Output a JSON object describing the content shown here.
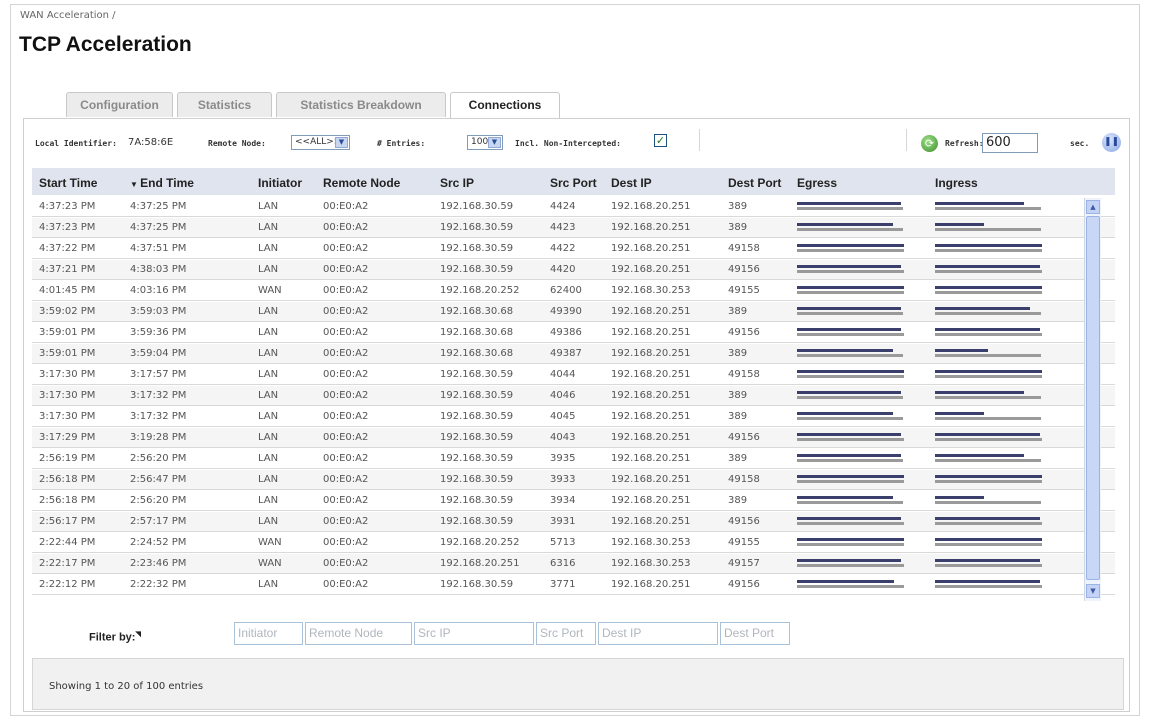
{
  "breadcrumb": "WAN Acceleration /",
  "title": "TCP Acceleration",
  "tabs": [
    {
      "label": "Configuration"
    },
    {
      "label": "Statistics"
    },
    {
      "label": "Statistics Breakdown"
    },
    {
      "label": "Connections"
    }
  ],
  "active_tab": "Connections",
  "toolbar": {
    "local_identifier_label": "Local Identifier:",
    "local_identifier_value": "7A:58:6E",
    "remote_node_label": "Remote Node:",
    "remote_node_value": "<<ALL>>",
    "entries_label": "# Entries:",
    "entries_value": "100",
    "non_intercepted_label": "Incl. Non-Intercepted:",
    "non_intercepted_checked": true,
    "refresh_label": "Refresh:",
    "refresh_value": "600",
    "refresh_unit": "sec."
  },
  "columns": [
    "Start Time",
    "End Time",
    "Initiator",
    "Remote Node",
    "Src IP",
    "Src Port",
    "Dest IP",
    "Dest Port",
    "Egress",
    "Ingress"
  ],
  "sort_column": "End Time",
  "rows": [
    {
      "start": "4:37:23 PM",
      "end": "4:37:25 PM",
      "initiator": "LAN",
      "node": "00:E0:A2",
      "src_ip": "192.168.30.59",
      "src_port": "4424",
      "dest_ip": "192.168.20.251",
      "dest_port": "389",
      "egress": [
        0.96,
        0.98
      ],
      "ingress": [
        0.82,
        0.98
      ]
    },
    {
      "start": "4:37:23 PM",
      "end": "4:37:25 PM",
      "initiator": "LAN",
      "node": "00:E0:A2",
      "src_ip": "192.168.30.59",
      "src_port": "4423",
      "dest_ip": "192.168.20.251",
      "dest_port": "389",
      "egress": [
        0.89,
        0.98
      ],
      "ingress": [
        0.45,
        0.98
      ]
    },
    {
      "start": "4:37:22 PM",
      "end": "4:37:51 PM",
      "initiator": "LAN",
      "node": "00:E0:A2",
      "src_ip": "192.168.30.59",
      "src_port": "4422",
      "dest_ip": "192.168.20.251",
      "dest_port": "49158",
      "egress": [
        0.99,
        0.99
      ],
      "ingress": [
        0.99,
        0.99
      ]
    },
    {
      "start": "4:37:21 PM",
      "end": "4:38:03 PM",
      "initiator": "LAN",
      "node": "00:E0:A2",
      "src_ip": "192.168.30.59",
      "src_port": "4420",
      "dest_ip": "192.168.20.251",
      "dest_port": "49156",
      "egress": [
        0.96,
        0.99
      ],
      "ingress": [
        0.97,
        0.99
      ]
    },
    {
      "start": "4:01:45 PM",
      "end": "4:03:16 PM",
      "initiator": "WAN",
      "node": "00:E0:A2",
      "src_ip": "192.168.20.252",
      "src_port": "62400",
      "dest_ip": "192.168.30.253",
      "dest_port": "49155",
      "egress": [
        0.99,
        0.99
      ],
      "ingress": [
        0.99,
        0.99
      ]
    },
    {
      "start": "3:59:02 PM",
      "end": "3:59:03 PM",
      "initiator": "LAN",
      "node": "00:E0:A2",
      "src_ip": "192.168.30.68",
      "src_port": "49390",
      "dest_ip": "192.168.20.251",
      "dest_port": "389",
      "egress": [
        0.96,
        0.98
      ],
      "ingress": [
        0.88,
        0.98
      ]
    },
    {
      "start": "3:59:01 PM",
      "end": "3:59:36 PM",
      "initiator": "LAN",
      "node": "00:E0:A2",
      "src_ip": "192.168.30.68",
      "src_port": "49386",
      "dest_ip": "192.168.20.251",
      "dest_port": "49156",
      "egress": [
        0.96,
        0.99
      ],
      "ingress": [
        0.97,
        0.99
      ]
    },
    {
      "start": "3:59:01 PM",
      "end": "3:59:04 PM",
      "initiator": "LAN",
      "node": "00:E0:A2",
      "src_ip": "192.168.30.68",
      "src_port": "49387",
      "dest_ip": "192.168.20.251",
      "dest_port": "389",
      "egress": [
        0.89,
        0.98
      ],
      "ingress": [
        0.49,
        0.98
      ]
    },
    {
      "start": "3:17:30 PM",
      "end": "3:17:57 PM",
      "initiator": "LAN",
      "node": "00:E0:A2",
      "src_ip": "192.168.30.59",
      "src_port": "4044",
      "dest_ip": "192.168.20.251",
      "dest_port": "49158",
      "egress": [
        0.99,
        0.99
      ],
      "ingress": [
        0.99,
        0.99
      ]
    },
    {
      "start": "3:17:30 PM",
      "end": "3:17:32 PM",
      "initiator": "LAN",
      "node": "00:E0:A2",
      "src_ip": "192.168.30.59",
      "src_port": "4046",
      "dest_ip": "192.168.20.251",
      "dest_port": "389",
      "egress": [
        0.96,
        0.98
      ],
      "ingress": [
        0.82,
        0.98
      ]
    },
    {
      "start": "3:17:30 PM",
      "end": "3:17:32 PM",
      "initiator": "LAN",
      "node": "00:E0:A2",
      "src_ip": "192.168.30.59",
      "src_port": "4045",
      "dest_ip": "192.168.20.251",
      "dest_port": "389",
      "egress": [
        0.89,
        0.98
      ],
      "ingress": [
        0.45,
        0.98
      ]
    },
    {
      "start": "3:17:29 PM",
      "end": "3:19:28 PM",
      "initiator": "LAN",
      "node": "00:E0:A2",
      "src_ip": "192.168.30.59",
      "src_port": "4043",
      "dest_ip": "192.168.20.251",
      "dest_port": "49156",
      "egress": [
        0.96,
        0.99
      ],
      "ingress": [
        0.97,
        0.99
      ]
    },
    {
      "start": "2:56:19 PM",
      "end": "2:56:20 PM",
      "initiator": "LAN",
      "node": "00:E0:A2",
      "src_ip": "192.168.30.59",
      "src_port": "3935",
      "dest_ip": "192.168.20.251",
      "dest_port": "389",
      "egress": [
        0.96,
        0.98
      ],
      "ingress": [
        0.82,
        0.98
      ]
    },
    {
      "start": "2:56:18 PM",
      "end": "2:56:47 PM",
      "initiator": "LAN",
      "node": "00:E0:A2",
      "src_ip": "192.168.30.59",
      "src_port": "3933",
      "dest_ip": "192.168.20.251",
      "dest_port": "49158",
      "egress": [
        0.99,
        0.99
      ],
      "ingress": [
        0.99,
        0.99
      ]
    },
    {
      "start": "2:56:18 PM",
      "end": "2:56:20 PM",
      "initiator": "LAN",
      "node": "00:E0:A2",
      "src_ip": "192.168.30.59",
      "src_port": "3934",
      "dest_ip": "192.168.20.251",
      "dest_port": "389",
      "egress": [
        0.89,
        0.98
      ],
      "ingress": [
        0.45,
        0.98
      ]
    },
    {
      "start": "2:56:17 PM",
      "end": "2:57:17 PM",
      "initiator": "LAN",
      "node": "00:E0:A2",
      "src_ip": "192.168.30.59",
      "src_port": "3931",
      "dest_ip": "192.168.20.251",
      "dest_port": "49156",
      "egress": [
        0.96,
        0.99
      ],
      "ingress": [
        0.97,
        0.99
      ]
    },
    {
      "start": "2:22:44 PM",
      "end": "2:24:52 PM",
      "initiator": "WAN",
      "node": "00:E0:A2",
      "src_ip": "192.168.20.252",
      "src_port": "5713",
      "dest_ip": "192.168.30.253",
      "dest_port": "49155",
      "egress": [
        0.99,
        0.99
      ],
      "ingress": [
        0.99,
        0.99
      ]
    },
    {
      "start": "2:22:17 PM",
      "end": "2:23:46 PM",
      "initiator": "WAN",
      "node": "00:E0:A2",
      "src_ip": "192.168.20.251",
      "src_port": "6316",
      "dest_ip": "192.168.30.253",
      "dest_port": "49157",
      "egress": [
        0.96,
        0.99
      ],
      "ingress": [
        0.97,
        0.99
      ]
    },
    {
      "start": "2:22:12 PM",
      "end": "2:22:32 PM",
      "initiator": "LAN",
      "node": "00:E0:A2",
      "src_ip": "192.168.30.59",
      "src_port": "3771",
      "dest_ip": "192.168.20.251",
      "dest_port": "49156",
      "egress": [
        0.9,
        0.99
      ],
      "ingress": [
        0.97,
        0.99
      ]
    }
  ],
  "filter": {
    "label": "Filter by:",
    "fields": [
      {
        "placeholder": "Initiator"
      },
      {
        "placeholder": "Remote Node"
      },
      {
        "placeholder": "Src IP"
      },
      {
        "placeholder": "Src Port"
      },
      {
        "placeholder": "Dest IP"
      },
      {
        "placeholder": "Dest Port"
      }
    ]
  },
  "footer_text": "Showing 1 to 20 of 100 entries",
  "colors": {
    "accent": "#3b3f6b",
    "header_bg": "#dfe4ee",
    "bar_gray": "#9a9a9a"
  }
}
